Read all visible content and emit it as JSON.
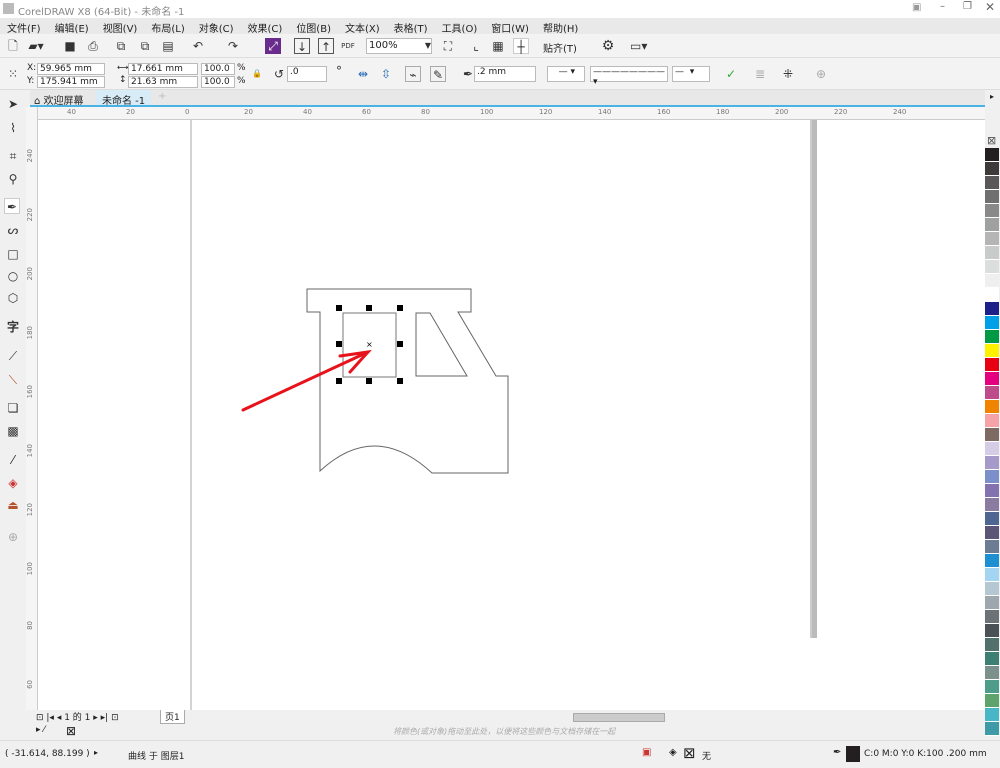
{
  "window": {
    "title": "CorelDRAW X8 (64-Bit) - 未命名 -1"
  },
  "menu": [
    "文件(F)",
    "编辑(E)",
    "视图(V)",
    "布局(L)",
    "对象(C)",
    "效果(C)",
    "位图(B)",
    "文本(X)",
    "表格(T)",
    "工具(O)",
    "窗口(W)",
    "帮助(H)"
  ],
  "toolbar": {
    "zoom": "100%",
    "snap": "贴齐(T)",
    "pdf": "PDF"
  },
  "property_bar": {
    "x": "59.965 mm",
    "y": "175.941 mm",
    "x_label": "X:",
    "y_label": "Y:",
    "width": "17.661 mm",
    "height": "21.63 mm",
    "scale_x": "100.0",
    "scale_y": "100.0",
    "pct": "%",
    "rotation": ".0",
    "outline": ".2 mm"
  },
  "tabs": [
    {
      "label": "欢迎屏幕",
      "icon": "home-icon"
    },
    {
      "label": "未命名 -1",
      "active": true
    }
  ],
  "rulers": {
    "h": [
      "40",
      "20",
      "0",
      "20",
      "40",
      "60",
      "80",
      "100",
      "120",
      "140",
      "160",
      "180",
      "200",
      "220",
      "240"
    ],
    "v": [
      "240",
      "220",
      "200",
      "180",
      "160",
      "140",
      "120",
      "100",
      "80",
      "60"
    ]
  },
  "page_nav": {
    "current": "1 的 1",
    "page_tab": "页1"
  },
  "color_docker_hint": "将颜色(或对象)拖动至此处，以便将这些颜色与文档存储在一起",
  "status": {
    "coords": "( -31.614, 88.199 )",
    "object": "曲线 于 图层1",
    "fill": "无",
    "outline_info": "C:0 M:0 Y:0 K:100  .200 mm"
  },
  "palette": [
    "#231f20",
    "#3e3a39",
    "#595757",
    "#717071",
    "#898989",
    "#9fa0a0",
    "#b5b5b6",
    "#c9caca",
    "#dcdddd",
    "#efefef",
    "#ffffff",
    "#1d2088",
    "#00a0e9",
    "#009944",
    "#fff100",
    "#e60012",
    "#e4007f",
    "#be4c8b",
    "#f08300",
    "#f5a3a6",
    "#7d6b63",
    "#d4cde5",
    "#a59aca",
    "#7b8fcb",
    "#8273b0",
    "#8c7ba0",
    "#4f6592",
    "#5b5577",
    "#6c7d93",
    "#1e8fd0",
    "#a3d5f2",
    "#b5c7d3",
    "#9ea7ad",
    "#6b7378",
    "#4b5257",
    "#52716d",
    "#3e7f74",
    "#7c918c",
    "#4f9c8a",
    "#5ea36b",
    "#49b6c8",
    "#3f9aa8"
  ],
  "colors": {
    "accent": "#4ab3e6",
    "arrow": "#e8121b"
  }
}
